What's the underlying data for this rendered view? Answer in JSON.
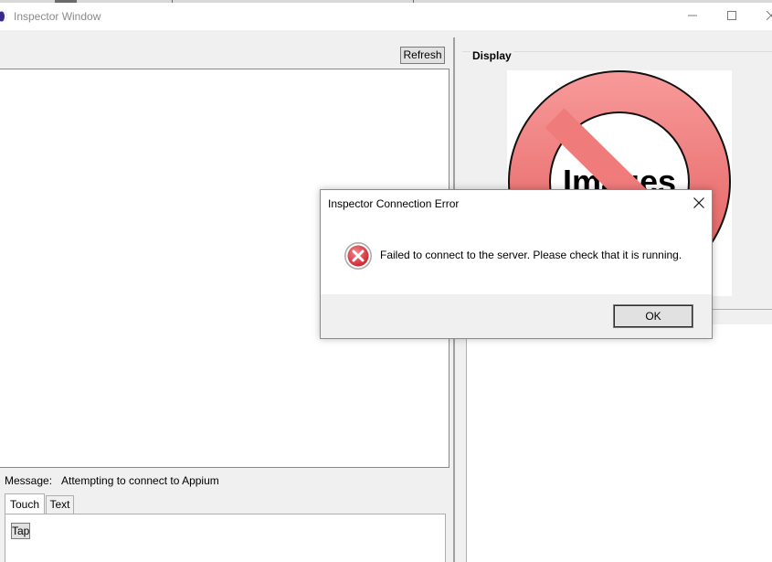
{
  "window": {
    "title": "Inspector Window"
  },
  "left_pane": {
    "refresh_label": "Refresh",
    "message_label": "Message:",
    "message_value": "Attempting to connect to Appium",
    "tabs": [
      {
        "label": "Touch",
        "active": true
      },
      {
        "label": "Text",
        "active": false
      }
    ],
    "touch_actions": [
      {
        "label": "Tap"
      }
    ]
  },
  "right_pane": {
    "display_label": "Display",
    "placeholder_text": "Images"
  },
  "dialog": {
    "title": "Inspector Connection Error",
    "message": "Failed to connect to the server. Please check that it is running.",
    "ok_label": "OK",
    "icon": "error-icon"
  },
  "colors": {
    "error_red": "#d9363e",
    "placeholder_red": "#f07b7b",
    "window_bg": "#f0f0f0"
  },
  "icons": {
    "app": "app-icon",
    "minimize": "minimize-icon",
    "maximize": "maximize-icon",
    "close": "close-icon"
  }
}
